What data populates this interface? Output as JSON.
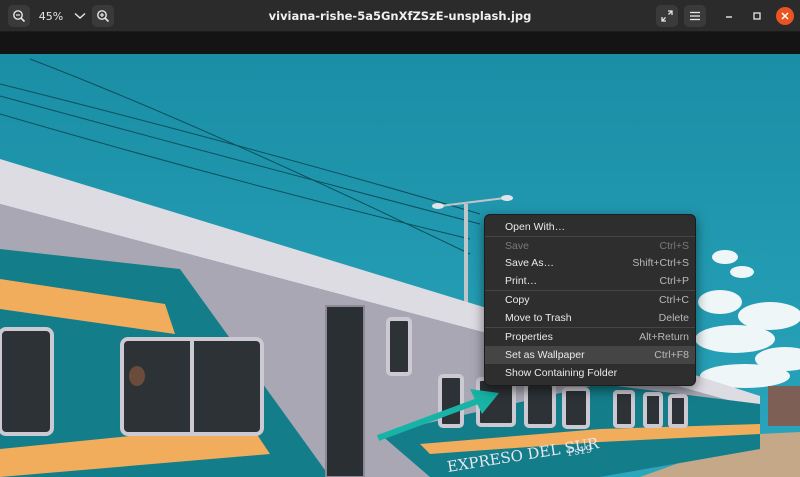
{
  "window": {
    "title": "viviana-rishe-5a5GnXfZSzE-unsplash.jpg",
    "zoom_level": "45%"
  },
  "icons": {
    "zoom_out": "zoom-out-icon",
    "zoom_menu": "chevron-down-icon",
    "zoom_in": "zoom-in-icon",
    "fullscreen": "fullscreen-icon",
    "menu": "hamburger-menu-icon",
    "minimize": "minimize-icon",
    "maximize": "maximize-icon",
    "close": "close-icon"
  },
  "photo": {
    "train_lettering": "EXPRESO DEL SUR",
    "car_number": "Fs19"
  },
  "context_menu": {
    "items": [
      {
        "label": "Open With…",
        "shortcut": "",
        "enabled": true
      },
      {
        "label": "Save",
        "shortcut": "Ctrl+S",
        "enabled": false
      },
      {
        "label": "Save As…",
        "shortcut": "Shift+Ctrl+S",
        "enabled": true
      },
      {
        "label": "Print…",
        "shortcut": "Ctrl+P",
        "enabled": true
      },
      {
        "label": "Copy",
        "shortcut": "Ctrl+C",
        "enabled": true
      },
      {
        "label": "Move to Trash",
        "shortcut": "Delete",
        "enabled": true
      },
      {
        "label": "Properties",
        "shortcut": "Alt+Return",
        "enabled": true
      },
      {
        "label": "Set as Wallpaper",
        "shortcut": "Ctrl+F8",
        "enabled": true,
        "highlighted": true
      },
      {
        "label": "Show Containing Folder",
        "shortcut": "",
        "enabled": true
      }
    ]
  },
  "colors": {
    "accent_close": "#e95420",
    "sky": "#1f97ad",
    "train_body": "#a9a7b4",
    "stripe_orange": "#f2ad5c",
    "stripe_teal": "#137e8a",
    "arrow": "#17b3a6"
  }
}
